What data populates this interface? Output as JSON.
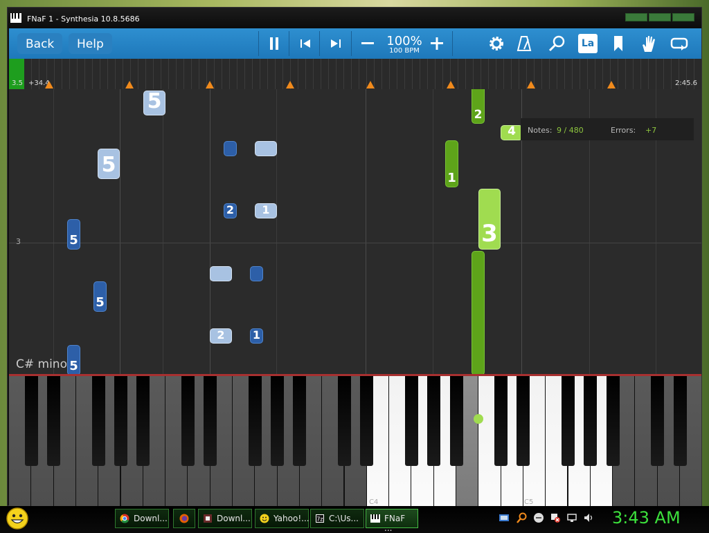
{
  "window": {
    "title": "FNaF 1 - Synthesia 10.8.5686"
  },
  "toolbar": {
    "back_label": "Back",
    "help_label": "Help",
    "speed_percent": "100%",
    "speed_bpm": "100 BPM",
    "la_label": "La"
  },
  "timeline": {
    "start": "3.5",
    "offset": "+34.4",
    "end": "2:45.6"
  },
  "stats": {
    "notes_label": "Notes:",
    "notes_value": "9  /  480",
    "errors_label": "Errors:",
    "errors_value": "+7"
  },
  "roll": {
    "key_signature": "C# minor",
    "octave_marker": "3",
    "notes": [
      {
        "finger": "5"
      },
      {
        "finger": "5"
      },
      {
        "finger": "5"
      },
      {
        "finger": "5"
      },
      {
        "finger": "5"
      },
      {
        "finger": "2"
      },
      {
        "finger": "1"
      },
      {
        "finger": "2"
      },
      {
        "finger": "1"
      },
      {
        "finger": "2"
      },
      {
        "finger": "4"
      },
      {
        "finger": "1"
      },
      {
        "finger": "3"
      }
    ]
  },
  "keyboard": {
    "labels": [
      "C4",
      "C5"
    ]
  },
  "taskbar": {
    "tasks": [
      {
        "label": "Downl..."
      },
      {
        "label": ""
      },
      {
        "label": "Downl..."
      },
      {
        "label": "Yahoo!..."
      },
      {
        "label": "C:\\Us..."
      },
      {
        "label": "FNaF ..."
      }
    ],
    "clock": "3:43 AM"
  },
  "colors": {
    "toolbar": "#1e78ba",
    "progress": "#1e9e1e",
    "played_note": "#5ea41a",
    "upcoming_note": "#2d5fa8",
    "marker": "#f08a1c",
    "clock": "#3ce03c"
  }
}
